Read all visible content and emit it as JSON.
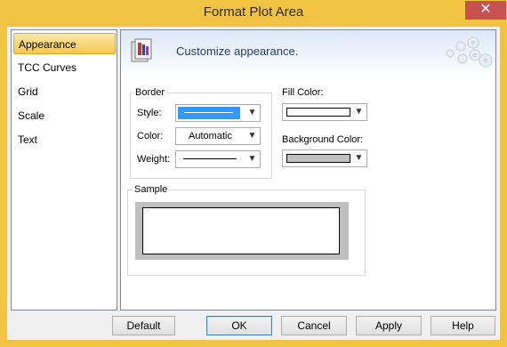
{
  "window": {
    "title": "Format Plot Area",
    "close_symbol": "✕"
  },
  "nav": {
    "items": [
      {
        "label": "Appearance",
        "selected": true
      },
      {
        "label": "TCC Curves",
        "selected": false
      },
      {
        "label": "Grid",
        "selected": false
      },
      {
        "label": "Scale",
        "selected": false
      },
      {
        "label": "Text",
        "selected": false
      }
    ]
  },
  "banner": {
    "text": "Customize appearance.",
    "icon": "appearance-icon"
  },
  "border_group": {
    "label": "Border",
    "style_label": "Style:",
    "color_label": "Color:",
    "color_value": "Automatic",
    "weight_label": "Weight:"
  },
  "fill_color": {
    "label": "Fill Color:",
    "swatch": "#ffffff"
  },
  "background_color": {
    "label": "Background Color:",
    "swatch": "#c0c0c0"
  },
  "sample": {
    "label": "Sample"
  },
  "buttons": {
    "default": "Default",
    "ok": "OK",
    "cancel": "Cancel",
    "apply": "Apply",
    "help": "Help"
  },
  "colors": {
    "accent": "#f2c343",
    "selection": "#3399ff",
    "close": "#c75050"
  }
}
